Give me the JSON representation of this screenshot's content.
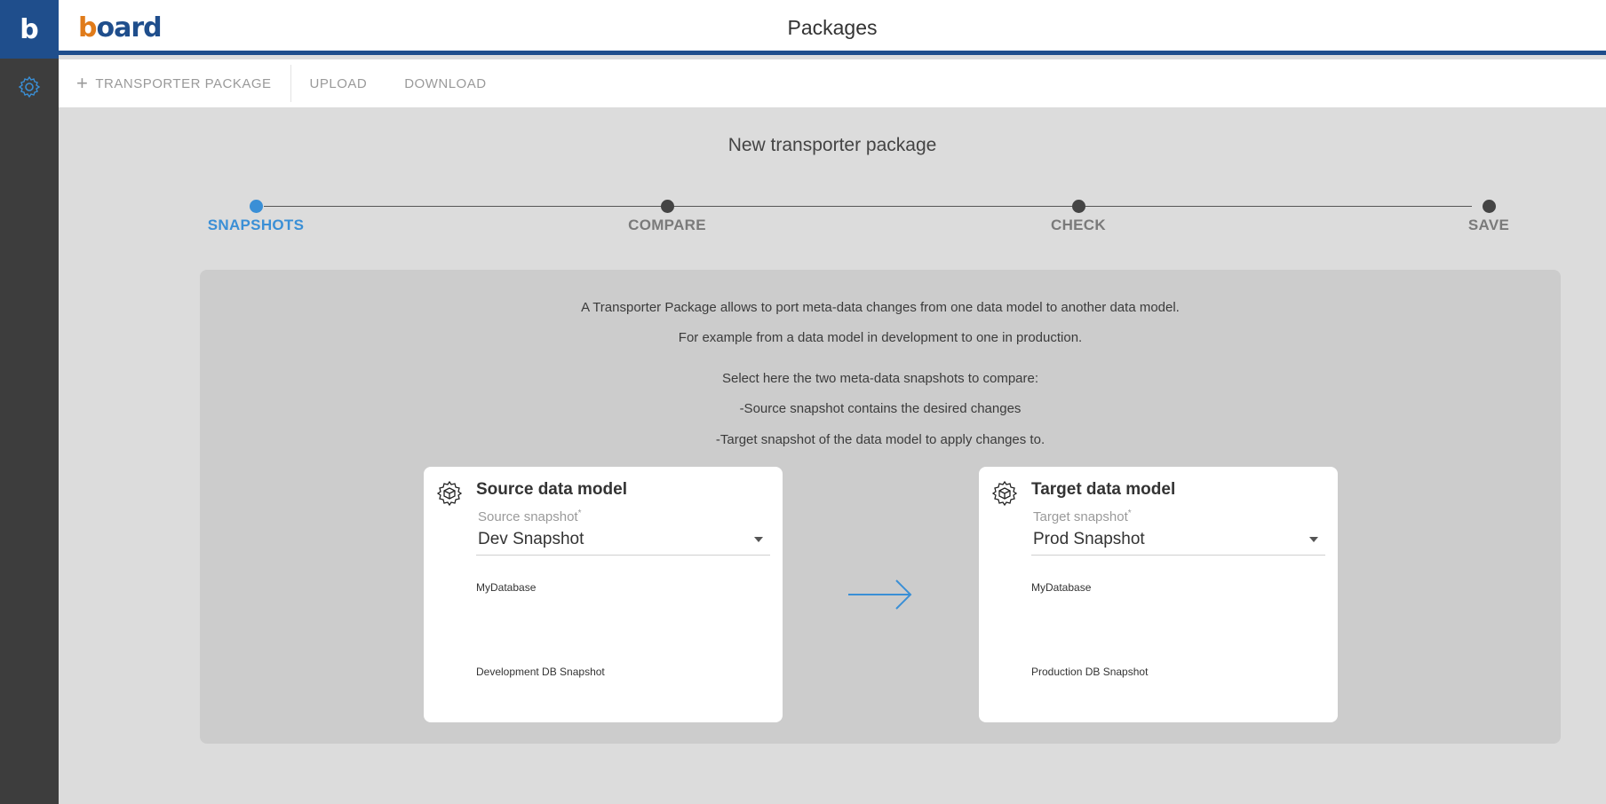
{
  "app": {
    "rail_logo": "b",
    "brand": {
      "prefix": "b",
      "rest": "oard"
    },
    "page_title": "Packages"
  },
  "toolbar": {
    "new_package": "TRANSPORTER PACKAGE",
    "upload": "UPLOAD",
    "download": "DOWNLOAD"
  },
  "main": {
    "title": "New transporter package",
    "steps": [
      {
        "label": "SNAPSHOTS",
        "active": true
      },
      {
        "label": "COMPARE",
        "active": false
      },
      {
        "label": "CHECK",
        "active": false
      },
      {
        "label": "SAVE",
        "active": false
      }
    ],
    "description": [
      "A Transporter Package allows to port meta-data changes from one data model to another data model.",
      "For example from a data model in development to one in production.",
      "Select here the two meta-data snapshots to compare:",
      "-Source snapshot contains the desired changes",
      "-Target snapshot of the data model to apply changes to."
    ],
    "source": {
      "title": "Source data model",
      "field_label": "Source snapshot",
      "required_mark": "*",
      "selected": "Dev Snapshot",
      "database": "MyDatabase",
      "snapshot_description": "Development DB Snapshot"
    },
    "target": {
      "title": "Target data model",
      "field_label": "Target snapshot",
      "required_mark": "*",
      "selected": "Prod Snapshot",
      "database": "MyDatabase",
      "snapshot_description": "Production DB Snapshot"
    }
  },
  "colors": {
    "brand_blue": "#1f4e8c",
    "accent_blue": "#3a8fd6",
    "rail": "#3d3d3d",
    "logo_orange": "#e07b1a"
  },
  "icons": {
    "rail_settings": "gear-icon",
    "add": "plus-icon",
    "data_model": "cube-gear-icon",
    "flow": "arrow-right-icon",
    "dropdown": "chevron-down-icon"
  }
}
